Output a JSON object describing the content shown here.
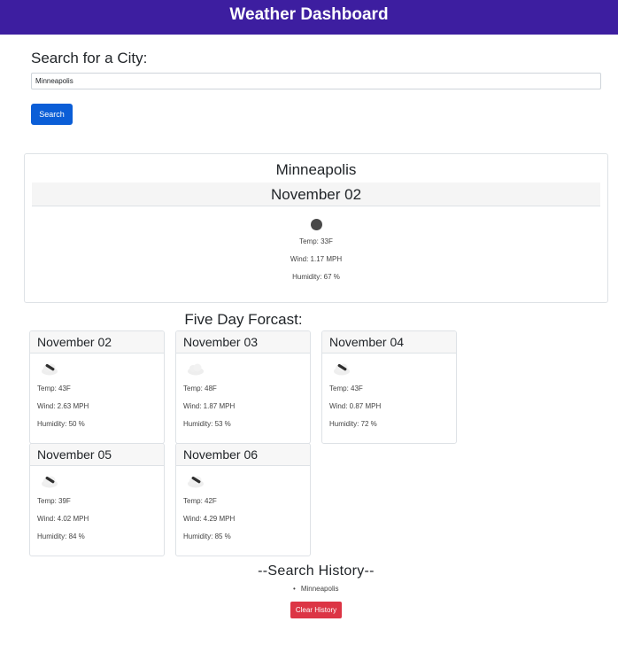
{
  "header": {
    "title": "Weather Dashboard"
  },
  "search": {
    "heading": "Search for a City:",
    "input_value": "Minneapolis",
    "button_label": "Search"
  },
  "current": {
    "city": "Minneapolis",
    "date": "November 02",
    "icon": "dark-moon-icon",
    "temp": "Temp: 33F",
    "wind": "Wind: 1.17 MPH",
    "humidity": "Humidity: 67 %"
  },
  "forecast": {
    "heading": "Five Day Forcast:",
    "days": [
      {
        "date": "November 02",
        "icon": "cloud-rain-icon",
        "temp": "Temp: 43F",
        "wind": "Wind: 2.63 MPH",
        "humidity": "Humidity: 50 %"
      },
      {
        "date": "November 03",
        "icon": "cloud-icon",
        "temp": "Temp: 48F",
        "wind": "Wind: 1.87 MPH",
        "humidity": "Humidity: 53 %"
      },
      {
        "date": "November 04",
        "icon": "cloud-rain-icon",
        "temp": "Temp: 43F",
        "wind": "Wind: 0.87 MPH",
        "humidity": "Humidity: 72 %"
      },
      {
        "date": "November 05",
        "icon": "cloud-rain-icon",
        "temp": "Temp: 39F",
        "wind": "Wind: 4.02 MPH",
        "humidity": "Humidity: 84 %"
      },
      {
        "date": "November 06",
        "icon": "cloud-rain-icon",
        "temp": "Temp: 42F",
        "wind": "Wind: 4.29 MPH",
        "humidity": "Humidity: 85 %"
      }
    ]
  },
  "history": {
    "heading": "--Search History--",
    "items": [
      "Minneapolis"
    ],
    "clear_label": "Clear History"
  },
  "colors": {
    "header_bg": "#3d1ea0",
    "search_button": "#0b5ed7",
    "clear_button": "#dc3545"
  }
}
